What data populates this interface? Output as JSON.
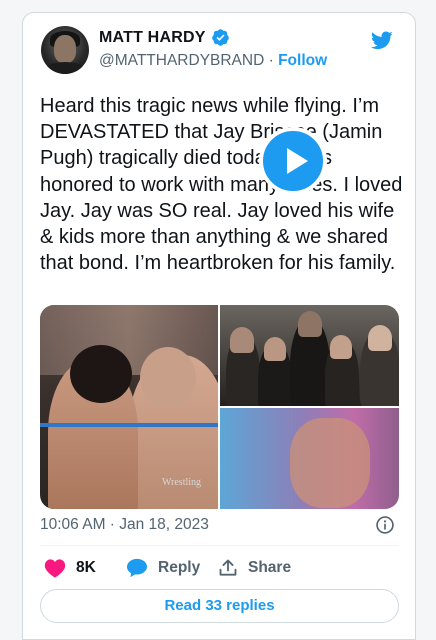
{
  "author": {
    "name": "MATT HARDY",
    "handle": "@MATTHARDYBRAND",
    "separator": "·",
    "follow_label": "Follow",
    "verified": true
  },
  "tweet": {
    "text": "Heard this tragic news while flying. I’m DEVASTATED that Jay Briscoe (Jamin Pugh) tragically died today. I was honored to work with many times. I loved Jay. Jay was SO real. Jay loved his wife & kids more than anything & we shared that bond. I’m heartbroken for his family.",
    "timestamp": "10:06 AM · Jan 18, 2023"
  },
  "media": {
    "watermark": "Wrestling"
  },
  "actions": {
    "likes": "8K",
    "reply_label": "Reply",
    "share_label": "Share"
  },
  "replies_button": "Read 33 replies",
  "colors": {
    "accent": "#1d9bf0",
    "like": "#f91880",
    "text": "#0f1419",
    "muted": "#536471"
  },
  "icons": [
    "verified-badge-icon",
    "twitter-bird-icon",
    "play-icon",
    "info-icon",
    "heart-icon",
    "reply-bubble-icon",
    "share-icon"
  ]
}
